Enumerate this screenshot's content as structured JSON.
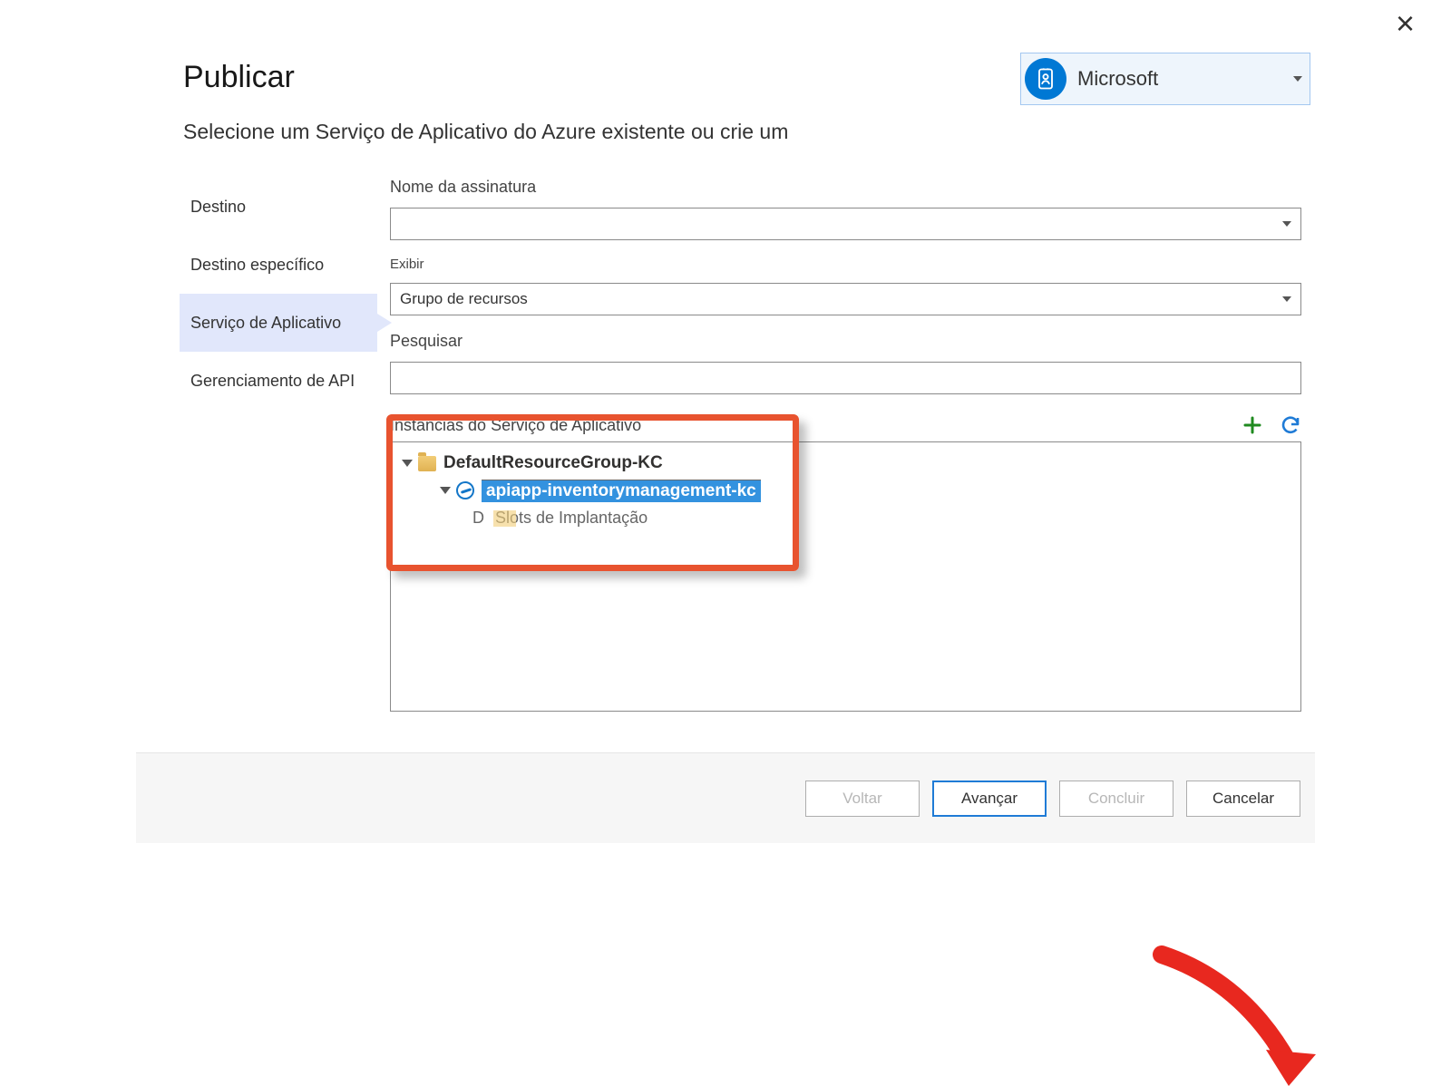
{
  "header": {
    "title": "Publicar",
    "subtitle": "Selecione um Serviço de Aplicativo do Azure existente ou crie um"
  },
  "account": {
    "name": "Microsoft"
  },
  "sidebar": {
    "items": [
      {
        "label": "Destino"
      },
      {
        "label": "Destino específico"
      },
      {
        "label": "Serviço de Aplicativo"
      },
      {
        "label": "Gerenciamento de API"
      }
    ]
  },
  "fields": {
    "subscription_label": "Nome da assinatura",
    "subscription_value": "",
    "view_label": "Exibir",
    "view_value": "Grupo de recursos",
    "search_label": "Pesquisar",
    "search_value": ""
  },
  "instances": {
    "label": "Instâncias do Serviço de Aplicativo",
    "resource_group": "DefaultResourceGroup-KC",
    "app_name": "apiapp-inventorymanagement-kc",
    "slot_prefix": "D",
    "slot_rest": "Slots de Implantação"
  },
  "buttons": {
    "back": "Voltar",
    "next": "Avançar",
    "finish": "Concluir",
    "cancel": "Cancelar"
  }
}
